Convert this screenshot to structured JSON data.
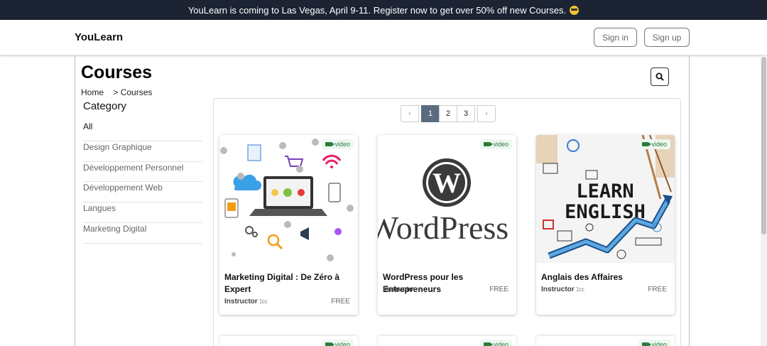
{
  "announcement": "YouLearn is coming to Las Vegas, April 9-11. Register now to get over 50% off new Courses.",
  "brand": "YouLearn",
  "nav": {
    "sign_in": "Sign in",
    "sign_up": "Sign up"
  },
  "page_title": "Courses",
  "breadcrumb": {
    "home": "Home",
    "sep": ">",
    "current": "Courses"
  },
  "category": {
    "title": "Category",
    "items": [
      "All",
      "Design Graphique",
      "Développement Personnel",
      "Développement Web",
      "Langues",
      "Marketing Digital"
    ]
  },
  "pagination": {
    "prev": "‹",
    "pages": [
      "1",
      "2",
      "3"
    ],
    "next": "›",
    "active": "1"
  },
  "badge_label": "video",
  "instructor_label": "Instructor :",
  "courses": [
    {
      "title": "Marketing Digital : De Zéro à Expert",
      "instructor": "cc",
      "price": "FREE",
      "image": "marketing-illustration"
    },
    {
      "title": "WordPress pour les Entrepreneurs",
      "instructor": "cc",
      "price": "FREE",
      "image": "wordpress-logo",
      "logo_text": "WordPress"
    },
    {
      "title": "Anglais des Affaires",
      "instructor": "cc",
      "price": "FREE",
      "image": "learn-english-sketch",
      "image_text": [
        "LEARN",
        "ENGLISH"
      ]
    }
  ]
}
